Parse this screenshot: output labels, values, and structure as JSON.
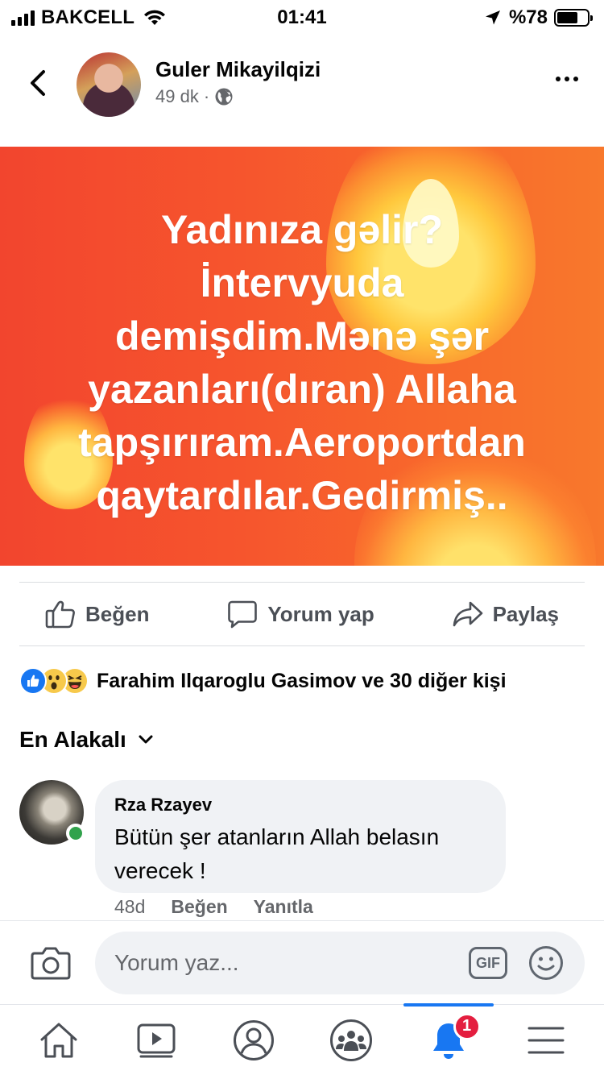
{
  "status_bar": {
    "carrier": "BAKCELL",
    "time": "01:41",
    "battery_text": "%78",
    "battery_level": 0.78
  },
  "post": {
    "author": "Guler Mikayilqizi",
    "time": "49 dk",
    "meta_separator": "·",
    "privacy_icon": "globe-icon",
    "image_text": "Yadınıza gəlir?\nİntervyuda\ndemişdim.Mənə şər\nyazanları(dıran) Allaha\ntapşırıram.Aeroportdan\nqaytardılar.Gedirmiş..",
    "image_bg_color": "#f6552d"
  },
  "actions": {
    "like": "Beğen",
    "comment": "Yorum yap",
    "share": "Paylaş"
  },
  "reactions": {
    "text": "Farahim Ilqaroglu Gasimov ve 30 diğer kişi",
    "icons": [
      "like-icon",
      "wow-icon",
      "haha-icon"
    ]
  },
  "sort": {
    "label": "En Alakalı"
  },
  "comment": {
    "author": "Rza Rzayev",
    "text": "Bütün şer atanların Allah belasın verecek !",
    "time": "48d",
    "like": "Beğen",
    "reply": "Yanıtla"
  },
  "composer": {
    "placeholder": "Yorum yaz...",
    "gif_label": "GIF"
  },
  "bottom_nav": {
    "notification_badge": "1",
    "active": "notifications",
    "accent_color": "#1877f2"
  }
}
